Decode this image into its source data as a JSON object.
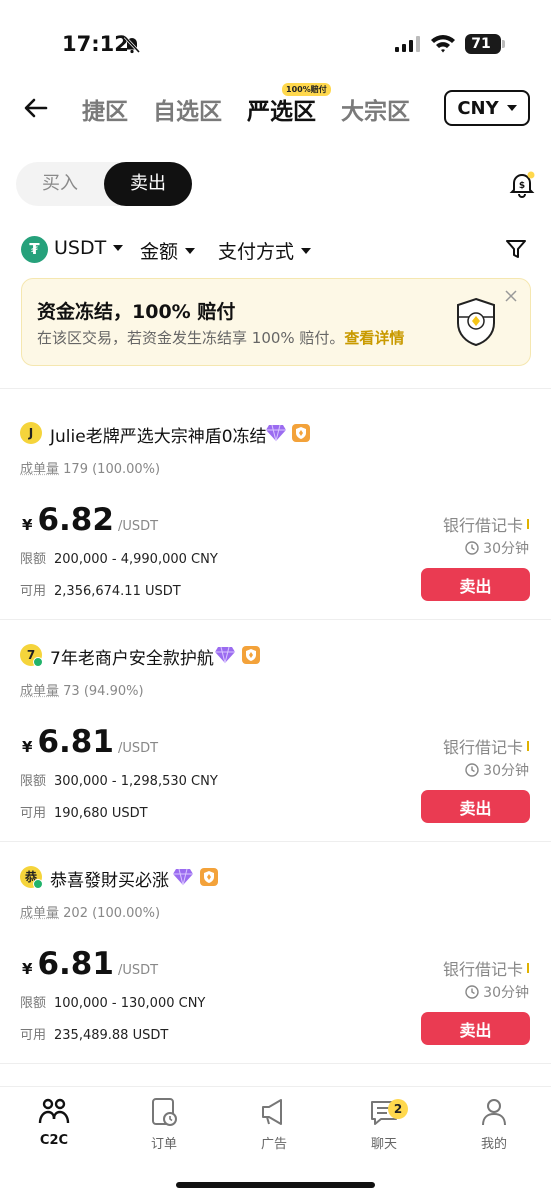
{
  "status_bar": {
    "time": "17:12",
    "battery": "71"
  },
  "header": {
    "tabs": [
      {
        "label": "捷区"
      },
      {
        "label": "自选区"
      },
      {
        "label": "严选区"
      },
      {
        "label": "大宗区"
      }
    ],
    "active_tab_badge": "100%赔付",
    "currency": "CNY"
  },
  "toggle": {
    "buy": "买入",
    "sell": "卖出"
  },
  "filters": {
    "coin": "USDT",
    "amount": "金额",
    "payment": "支付方式"
  },
  "banner": {
    "title": "资金冻结，100% 赔付",
    "desc": "在该区交易，若资金发生冻结享 100% 赔付。",
    "link": "查看详情"
  },
  "listings": [
    {
      "avatar": "J",
      "name": "Julie老牌严选大宗神盾0冻结",
      "orders_label": "成单量",
      "orders_value": "179 (100.00%)",
      "currency_symbol": "¥",
      "price": "6.82",
      "unit": "/USDT",
      "limit_label": "限额",
      "limit_value": "200,000 - 4,990,000 CNY",
      "avail_label": "可用",
      "avail_value": "2,356,674.11 USDT",
      "payment": "银行借记卡",
      "time_limit": "30分钟",
      "action": "卖出"
    },
    {
      "avatar": "7",
      "name": "7年老商户安全款护航",
      "orders_label": "成单量",
      "orders_value": "73 (94.90%)",
      "currency_symbol": "¥",
      "price": "6.81",
      "unit": "/USDT",
      "limit_label": "限额",
      "limit_value": "300,000 - 1,298,530 CNY",
      "avail_label": "可用",
      "avail_value": "190,680 USDT",
      "payment": "银行借记卡",
      "time_limit": "30分钟",
      "action": "卖出"
    },
    {
      "avatar": "恭",
      "name": "恭喜發財买必涨",
      "orders_label": "成单量",
      "orders_value": "202 (100.00%)",
      "currency_symbol": "¥",
      "price": "6.81",
      "unit": "/USDT",
      "limit_label": "限额",
      "limit_value": "100,000 - 130,000 CNY",
      "avail_label": "可用",
      "avail_value": "235,489.88 USDT",
      "payment": "银行借记卡",
      "time_limit": "30分钟",
      "action": "卖出"
    }
  ],
  "bottom_nav": {
    "items": [
      {
        "label": "C2C",
        "icon": "c2c-icon"
      },
      {
        "label": "订单",
        "icon": "orders-icon"
      },
      {
        "label": "广告",
        "icon": "megaphone-icon"
      },
      {
        "label": "聊天",
        "icon": "chat-icon"
      },
      {
        "label": "我的",
        "icon": "profile-icon"
      }
    ],
    "chat_badge": "2"
  },
  "colors": {
    "sell": "#ea3b52",
    "accent": "#ffd84d",
    "usdt": "#26a17b",
    "link": "#c99a00"
  }
}
